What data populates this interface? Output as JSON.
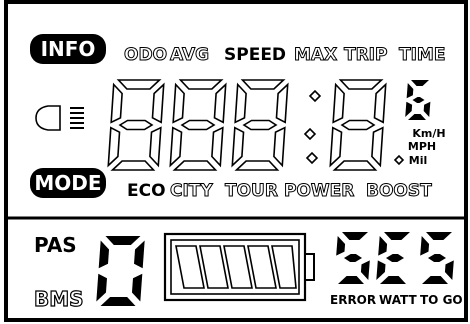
{
  "info_button": "INFO",
  "mode_button": "MODE",
  "readouts": [
    "ODO",
    "AVG",
    "SPEED",
    "MAX",
    "TRIP",
    "TIME"
  ],
  "active_readout": "SPEED",
  "assist_modes": [
    "ECO",
    "CITY",
    "TOUR",
    "POWER",
    "BOOST"
  ],
  "active_mode": "ECO",
  "units": [
    "Km/H",
    "MPH",
    "Mil"
  ],
  "gear": "6",
  "pas_label": "PAS",
  "pas_level": "0",
  "bms_label": "BMS",
  "error_code": "5E5",
  "bottom_labels": [
    "ERROR",
    "WATT",
    "TO GO"
  ],
  "colors": {
    "segment": "#000000",
    "background": "#ffffff"
  }
}
